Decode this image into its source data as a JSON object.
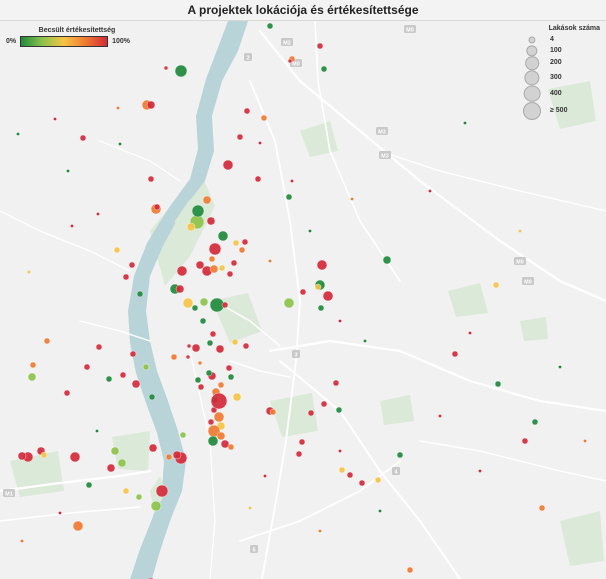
{
  "title": "A projektek lokációja és értékesítettsége",
  "legend_color": {
    "title": "Becsült értékesítettség",
    "min_label": "0%",
    "max_label": "100%"
  },
  "legend_size": {
    "title": "Lakások száma",
    "items": [
      {
        "label": "4",
        "value": 4
      },
      {
        "label": "100",
        "value": 100
      },
      {
        "label": "200",
        "value": 200
      },
      {
        "label": "300",
        "value": 300
      },
      {
        "label": "400",
        "value": 400
      },
      {
        "label": "≥ 500",
        "value": 500
      }
    ]
  },
  "road_shields": [
    "2",
    "M2",
    "M3",
    "M0",
    "3",
    "4",
    "5",
    "M1",
    "M0",
    "M0",
    "M3",
    "M0"
  ],
  "colors": {
    "low": "#1f8a3c",
    "mid_low": "#8cc34b",
    "mid": "#f6c344",
    "mid_high": "#ef7a30",
    "high": "#d42a3a",
    "river": "#b9d4d9",
    "park": "#dbe9d8",
    "land": "#f1f1f1",
    "road": "#ffffff"
  }
}
